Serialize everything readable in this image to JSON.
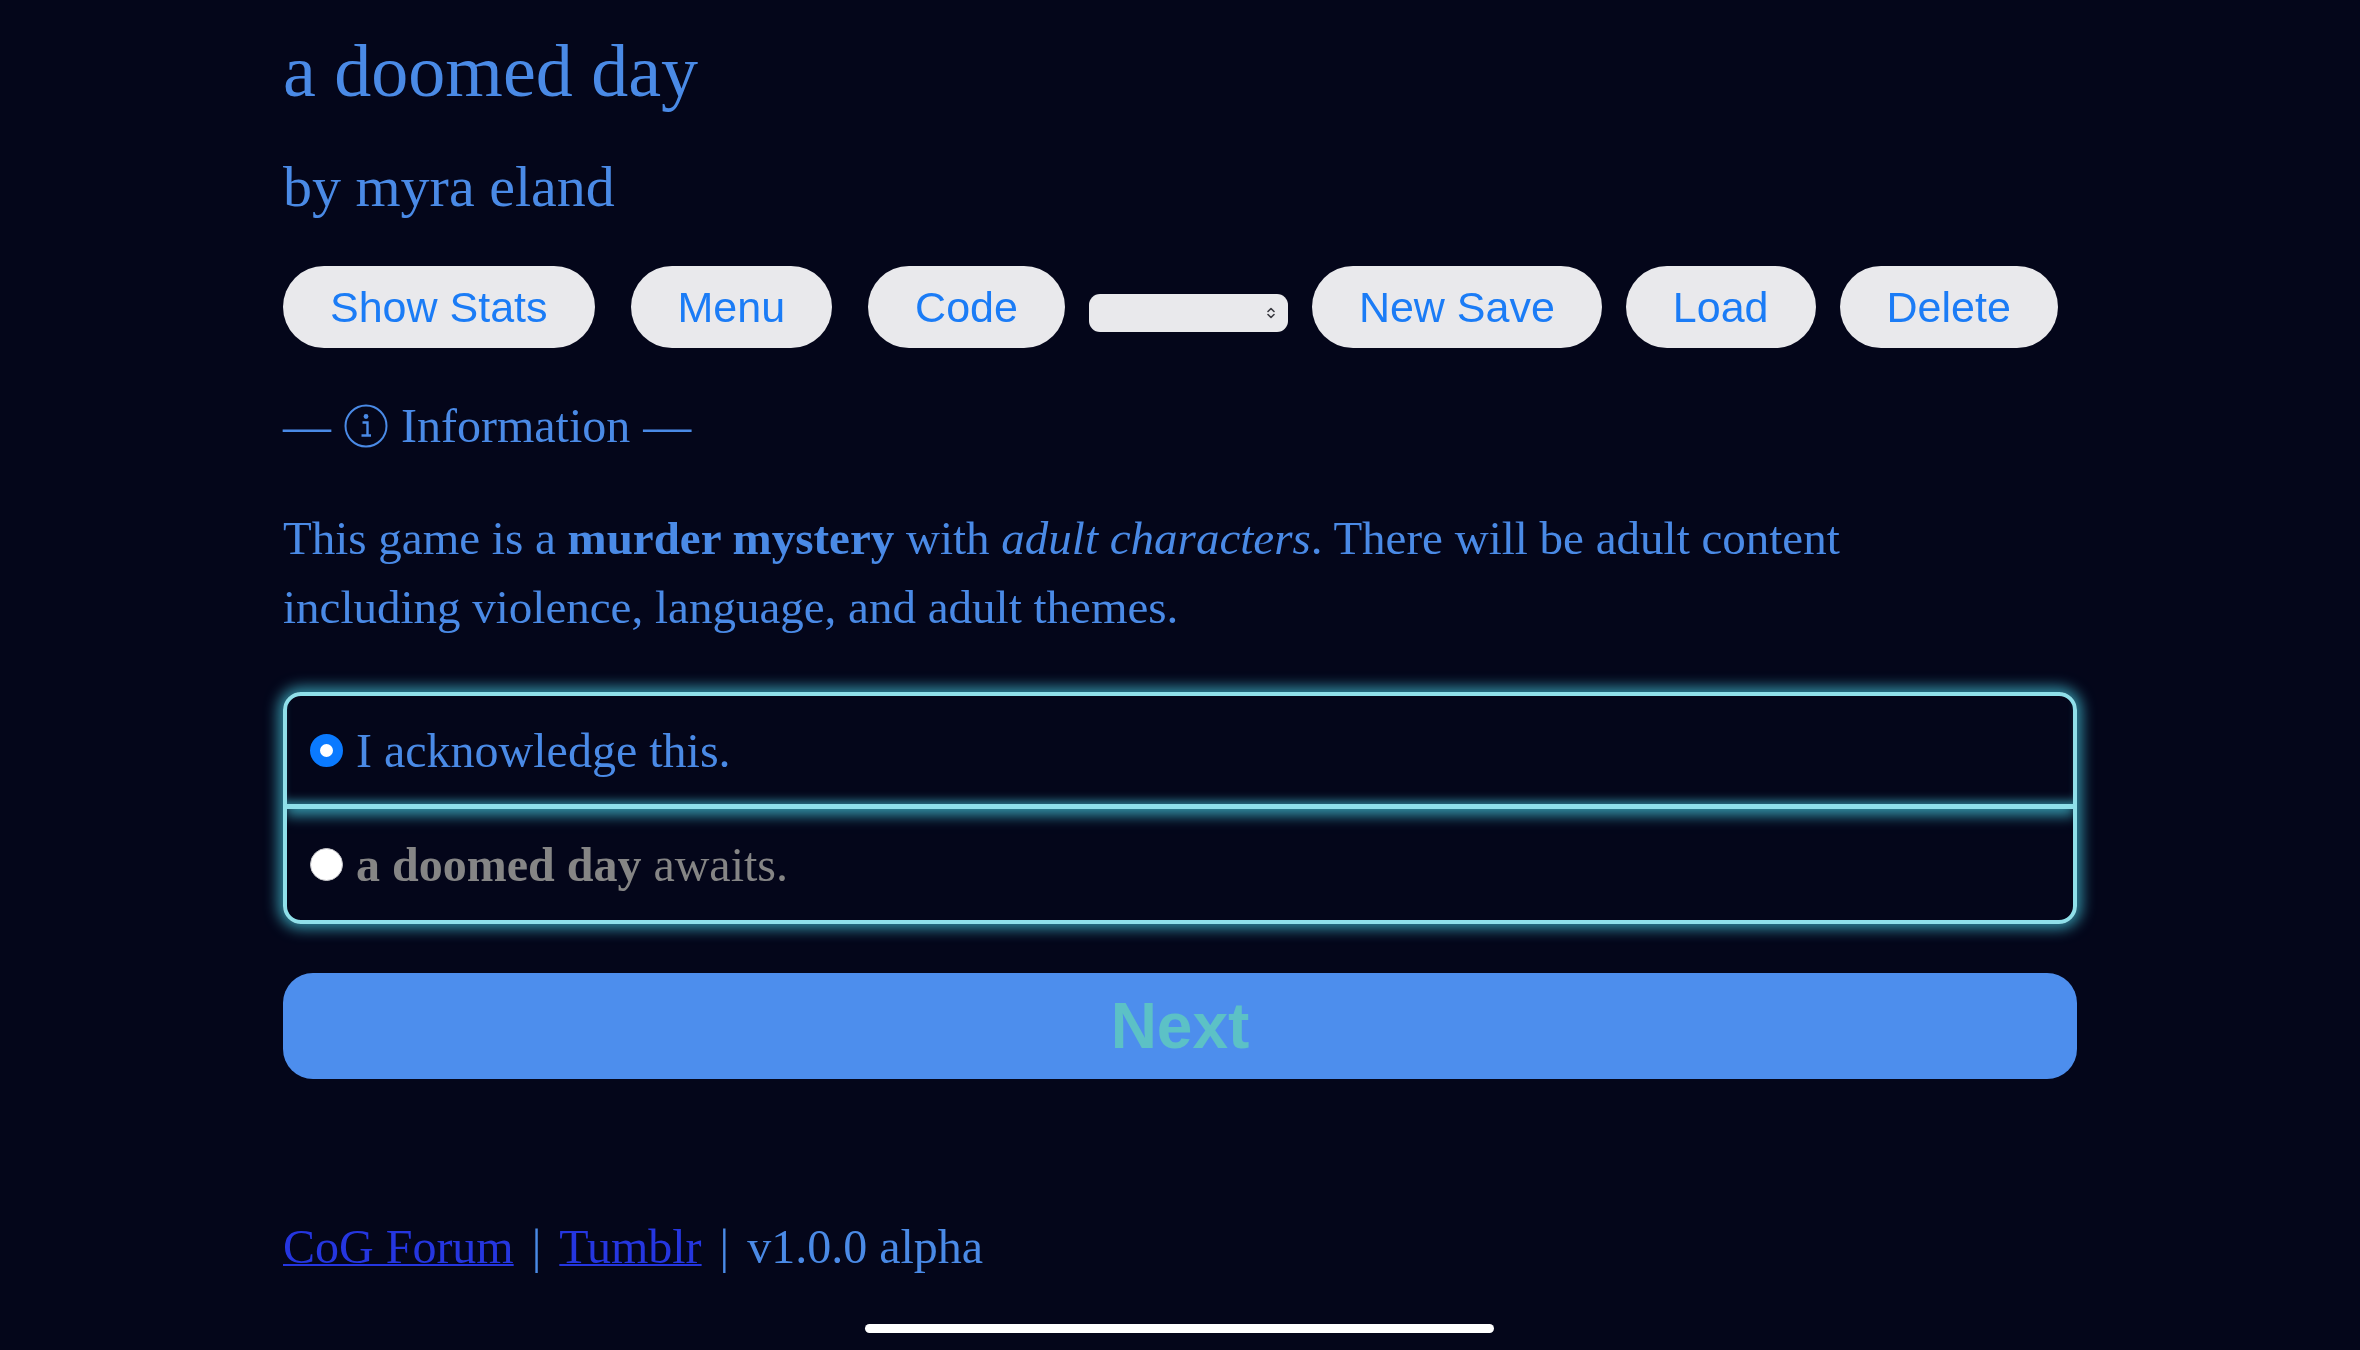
{
  "header": {
    "title": "a doomed day",
    "byline": "by myra eland"
  },
  "toolbar": [
    {
      "kind": "button",
      "label": "Show Stats"
    },
    {
      "kind": "button",
      "label": "Menu"
    },
    {
      "kind": "button",
      "label": "Code"
    },
    {
      "kind": "select"
    },
    {
      "kind": "button",
      "label": "New Save"
    },
    {
      "kind": "button",
      "label": "Load"
    },
    {
      "kind": "button",
      "label": "Delete"
    }
  ],
  "section_heading": {
    "before": "—",
    "text": "Information",
    "after": "—"
  },
  "body": "This game is a **murder mystery** with *adult characters*. There will be adult content including violence, language, and adult themes.",
  "choices": [
    {
      "text": "I acknowledge this.",
      "selected": true,
      "disabled": false
    },
    {
      "text": "**a doomed day** awaits.",
      "selected": false,
      "disabled": true
    }
  ],
  "next_button": {
    "label": "Next"
  },
  "footer": [
    {
      "kind": "link",
      "text": "CoG Forum"
    },
    {
      "kind": "separator",
      "text": "|"
    },
    {
      "kind": "link",
      "text": "Tumblr"
    },
    {
      "kind": "separator",
      "text": "|"
    },
    {
      "kind": "text",
      "text": "v1.0.0 alpha"
    }
  ]
}
